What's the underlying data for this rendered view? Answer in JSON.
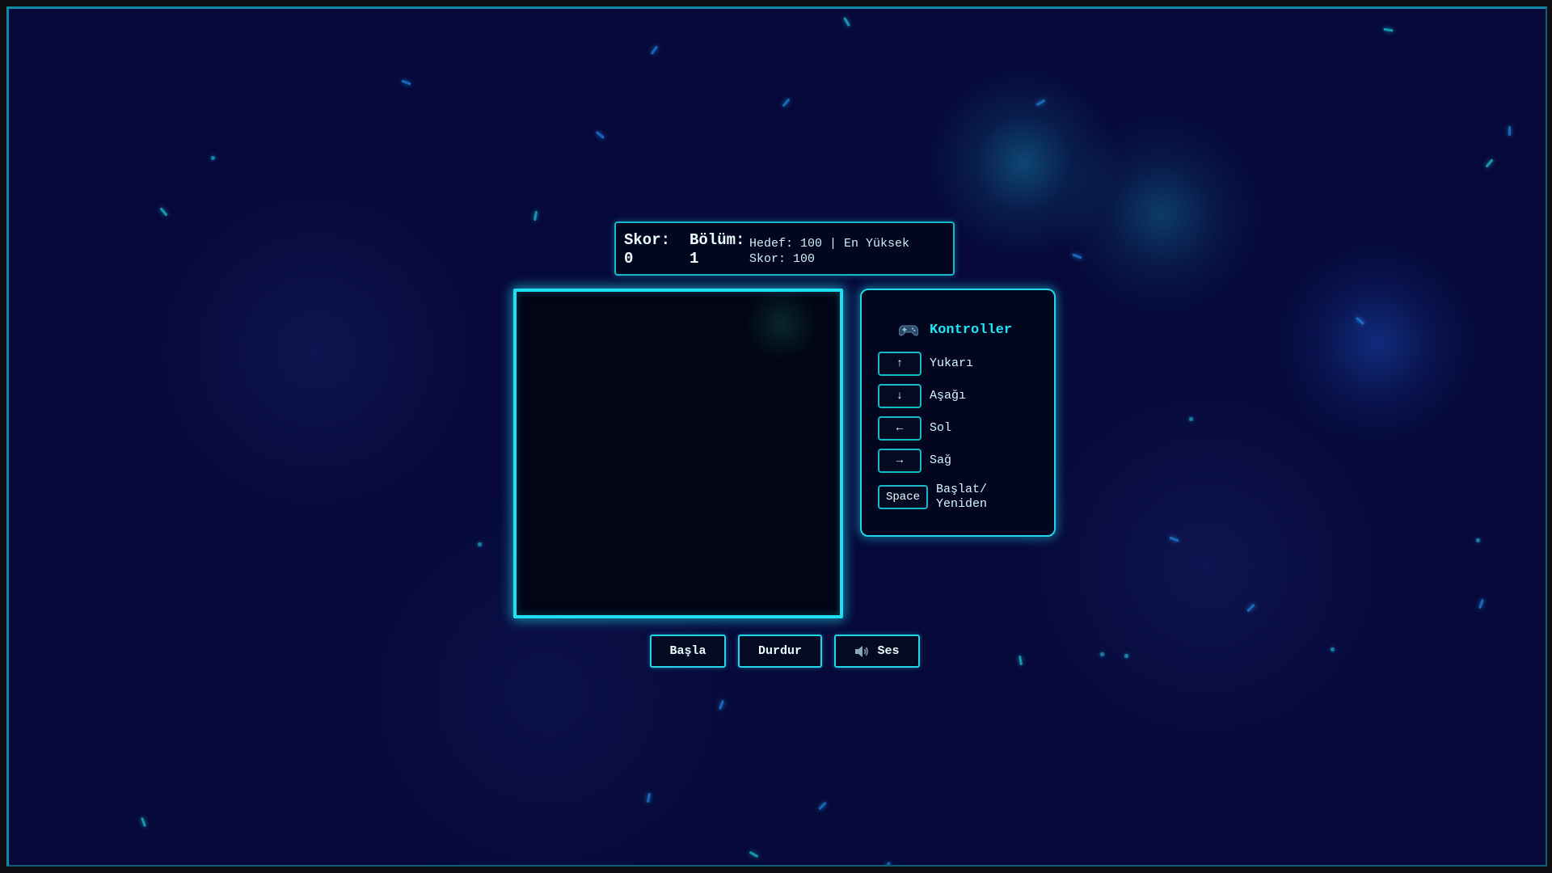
{
  "stats": {
    "score_label": "Skor:",
    "score_value": "0",
    "level_label": "Bölüm:",
    "level_value": "1",
    "target_text": "Hedef: 100 | En Yüksek Skor: 100"
  },
  "controls": {
    "title": "Kontroller",
    "items": [
      {
        "key": "↑",
        "label": "Yukarı"
      },
      {
        "key": "↓",
        "label": "Aşağı"
      },
      {
        "key": "←",
        "label": "Sol"
      },
      {
        "key": "→",
        "label": "Sağ"
      },
      {
        "key": "Space",
        "label": "Başlat/ Yeniden"
      }
    ]
  },
  "buttons": {
    "start": "Başla",
    "pause": "Durdur",
    "sound": "Ses"
  },
  "colors": {
    "accent": "#1fe0f0",
    "background": "#06093a",
    "board": "#010515"
  },
  "icons": {
    "controls": "gamepad-icon",
    "sound": "speaker-icon"
  }
}
